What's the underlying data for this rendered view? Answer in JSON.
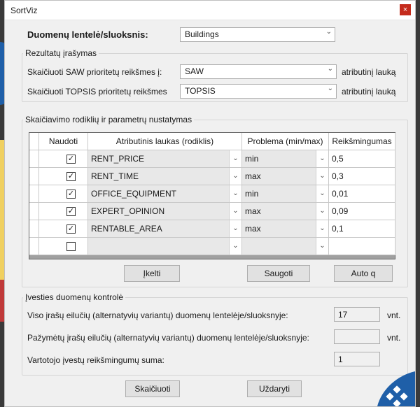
{
  "window": {
    "title": "SortViz",
    "close": "×"
  },
  "dataset": {
    "label": "Duomenų lentelė/sluoksnis:",
    "value": "Buildings"
  },
  "results": {
    "group_title": "Rezultatų įrašymas",
    "saw_label": "Skaičiuoti SAW prioritetų reikšmes į:",
    "saw_value": "SAW",
    "saw_suffix": "atributinį lauką",
    "topsis_label": "Skaičiuoti TOPSIS prioritetų reikšmes",
    "topsis_value": "TOPSIS",
    "topsis_suffix": "atributinį lauką"
  },
  "params": {
    "group_title": "Skaičiavimo rodiklių ir parametrų nustatymas",
    "columns": [
      "Naudoti",
      "Atributinis laukas (rodiklis)",
      "Problema (min/max)",
      "Reikšmingumas"
    ],
    "rows": [
      {
        "checked": true,
        "field": "RENT_PRICE",
        "problem": "min",
        "weight": "0,5"
      },
      {
        "checked": true,
        "field": "RENT_TIME",
        "problem": "max",
        "weight": "0,3"
      },
      {
        "checked": true,
        "field": "OFFICE_EQUIPMENT",
        "problem": "min",
        "weight": "0,01"
      },
      {
        "checked": true,
        "field": "EXPERT_OPINION",
        "problem": "max",
        "weight": "0,09"
      },
      {
        "checked": true,
        "field": "RENTABLE_AREA",
        "problem": "max",
        "weight": "0,1"
      },
      {
        "checked": false,
        "field": "",
        "problem": "",
        "weight": ""
      }
    ],
    "load_button": "Įkelti",
    "save_button": "Saugoti",
    "auto_button": "Auto q"
  },
  "control": {
    "group_title": "Įvesties duomenų kontrolė",
    "total_label": "Viso įrašų eilučių (alternatyvių variantų) duomenų lentelėje/sluoksnyje:",
    "total_value": "17",
    "total_unit": "vnt.",
    "selected_label": "Pažymėtų įrašų eilučių (alternatyvių variantų) duomenų lentelėje/sluoksnyje:",
    "selected_value": "",
    "selected_unit": "vnt.",
    "sum_label": "Vartotojo įvestų reikšmingumų suma:",
    "sum_value": "1"
  },
  "actions": {
    "compute": "Skaičiuoti",
    "close": "Uždaryti"
  },
  "icons": {
    "checkbox_checked": "☑",
    "dropdown": "chevron-down-icon"
  }
}
